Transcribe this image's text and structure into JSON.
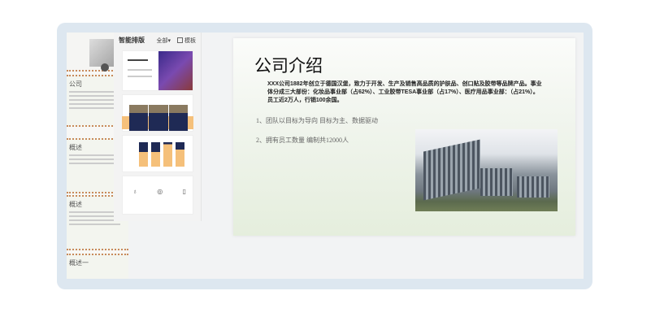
{
  "panel": {
    "title": "智能排版",
    "filter": "全部",
    "filter_icon": "chevron-down-icon",
    "template_button": "模板"
  },
  "thumbnails": [
    {
      "title": "公司"
    },
    {
      "title": "概述"
    },
    {
      "title": "概述"
    },
    {
      "title": "概述一"
    }
  ],
  "slide": {
    "title": "公司介绍",
    "paragraph": "XXX公司1882年创立于德国汉堡，致力于开发、生产及销售高品质的护肤品、创口贴及胶带等品牌产品。事业体分成三大部份：化妆品事业部（占62%）、工业胶带TESA事业部（占17%）、医疗用品事业部：（占21%）。员工近2万人，行销100余国。",
    "bullets": [
      "1、团队以目标为导向 目标为主、数据驱动",
      "2、拥有员工数量 编制共12000人"
    ]
  },
  "colors": {
    "accent": "#f5c07a",
    "navy": "#1f2a55",
    "frame": "#dde7f0"
  }
}
